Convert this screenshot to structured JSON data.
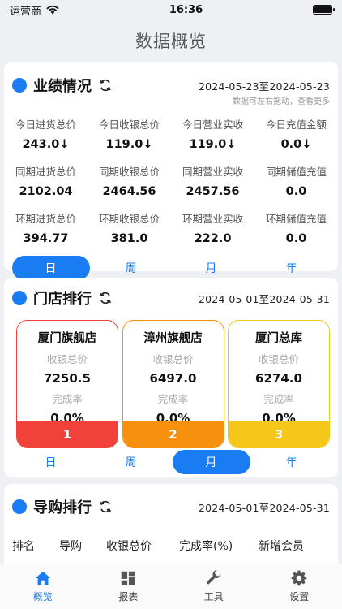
{
  "status": {
    "carrier": "运营商",
    "time": "16:36"
  },
  "nav": {
    "title": "数据概览"
  },
  "performance": {
    "title": "业绩情况",
    "date_range": "2024-05-23至2024-05-23",
    "hint": "数据可左右拖动，查看更多",
    "rows": [
      [
        {
          "label": "今日进货总价",
          "value": "243.0↓"
        },
        {
          "label": "今日收银总价",
          "value": "119.0↓"
        },
        {
          "label": "今日营业实收",
          "value": "119.0↓"
        },
        {
          "label": "今日充值金额",
          "value": "0.0↓"
        }
      ],
      [
        {
          "label": "同期进货总价",
          "value": "2102.04"
        },
        {
          "label": "同期收银总价",
          "value": "2464.56"
        },
        {
          "label": "同期营业实收",
          "value": "2457.56"
        },
        {
          "label": "同期储值充值",
          "value": "0.0"
        }
      ],
      [
        {
          "label": "环期进货总价",
          "value": "394.77"
        },
        {
          "label": "环期收银总价",
          "value": "381.0"
        },
        {
          "label": "环期营业实收",
          "value": "222.0"
        },
        {
          "label": "环期储值充值",
          "value": "0.0"
        }
      ]
    ],
    "tabs": [
      "日",
      "周",
      "月",
      "年"
    ],
    "active_tab": 0
  },
  "store_rank": {
    "title": "门店排行",
    "date_range": "2024-05-01至2024-05-31",
    "stores": [
      {
        "name": "厦门旗舰店",
        "sales_label": "收银总价",
        "sales": "7250.5",
        "rate_label": "完成率",
        "rate": "0.0%",
        "rank": "1",
        "color": "#f0423a"
      },
      {
        "name": "漳州旗舰店",
        "sales_label": "收银总价",
        "sales": "6497.0",
        "rate_label": "完成率",
        "rate": "0.0%",
        "rank": "2",
        "color": "#f7900f"
      },
      {
        "name": "厦门总库",
        "sales_label": "收银总价",
        "sales": "6274.0",
        "rate_label": "完成率",
        "rate": "0.0%",
        "rank": "3",
        "color": "#f5c71a"
      }
    ],
    "tabs": [
      "日",
      "周",
      "月",
      "年"
    ],
    "active_tab": 2
  },
  "guide_rank": {
    "title": "导购排行",
    "date_range": "2024-05-01至2024-05-31",
    "columns": [
      "排名",
      "导购",
      "收银总价",
      "完成率(%)",
      "新增会员"
    ]
  },
  "tabbar": [
    {
      "label": "概览",
      "icon": "home-icon",
      "active": true
    },
    {
      "label": "报表",
      "icon": "grid-icon",
      "active": false
    },
    {
      "label": "工具",
      "icon": "wrench-icon",
      "active": false
    },
    {
      "label": "设置",
      "icon": "gear-icon",
      "active": false
    }
  ],
  "colors": {
    "accent": "#1a7cf2"
  }
}
